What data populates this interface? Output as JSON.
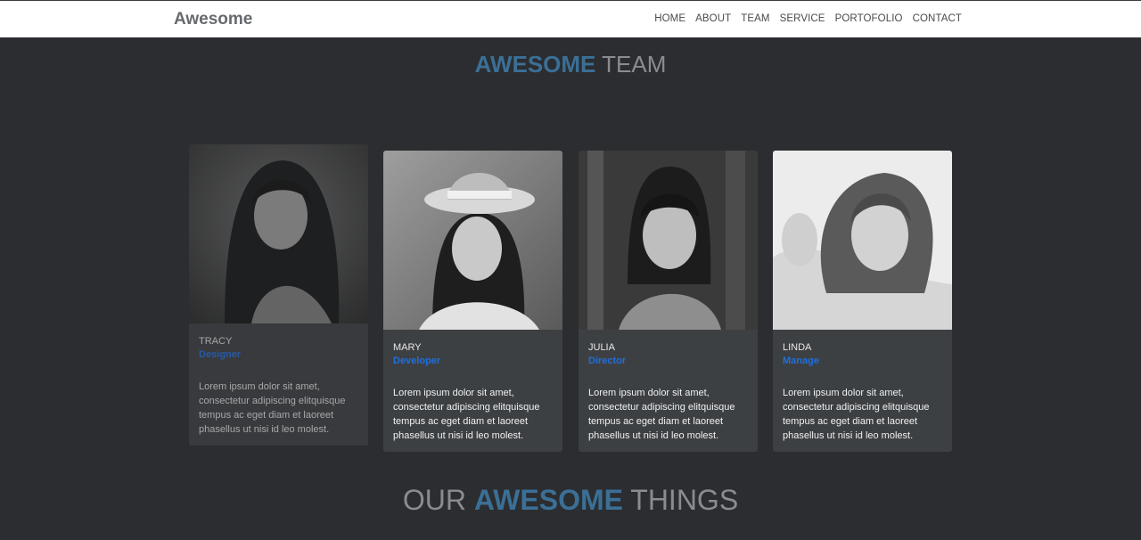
{
  "nav": {
    "brand": "Awesome",
    "links": [
      "HOME",
      "ABOUT",
      "TEAM",
      "SERVICE",
      "PORTOFOLIO",
      "CONTACT"
    ]
  },
  "team_section": {
    "title_accent": "AWESOME",
    "title_rest": " TEAM"
  },
  "members": [
    {
      "name": "TRACY",
      "role": "Designer",
      "bio": "Lorem ipsum dolor sit amet, consectetur adipiscing elitquisque tempus ac eget diam et laoreet phasellus ut nisi id leo molest."
    },
    {
      "name": "MARY",
      "role": "Developer",
      "bio": "Lorem ipsum dolor sit amet, consectetur adipiscing elitquisque tempus ac eget diam et laoreet phasellus ut nisi id leo molest."
    },
    {
      "name": "JULIA",
      "role": "Director",
      "bio": "Lorem ipsum dolor sit amet, consectetur adipiscing elitquisque tempus ac eget diam et laoreet phasellus ut nisi id leo molest."
    },
    {
      "name": "LINDA",
      "role": "Manage",
      "bio": "Lorem ipsum dolor sit amet, consectetur adipiscing elitquisque tempus ac eget diam et laoreet phasellus ut nisi id leo molest."
    }
  ],
  "things_section": {
    "title_pre": "OUR ",
    "title_accent": "AWESOME",
    "title_post": " THINGS"
  },
  "colors": {
    "page_bg": "#2b2d30",
    "card_bg": "#3d4043",
    "accent_blue": "#3b6f96",
    "role_blue": "#1f6fdc"
  }
}
